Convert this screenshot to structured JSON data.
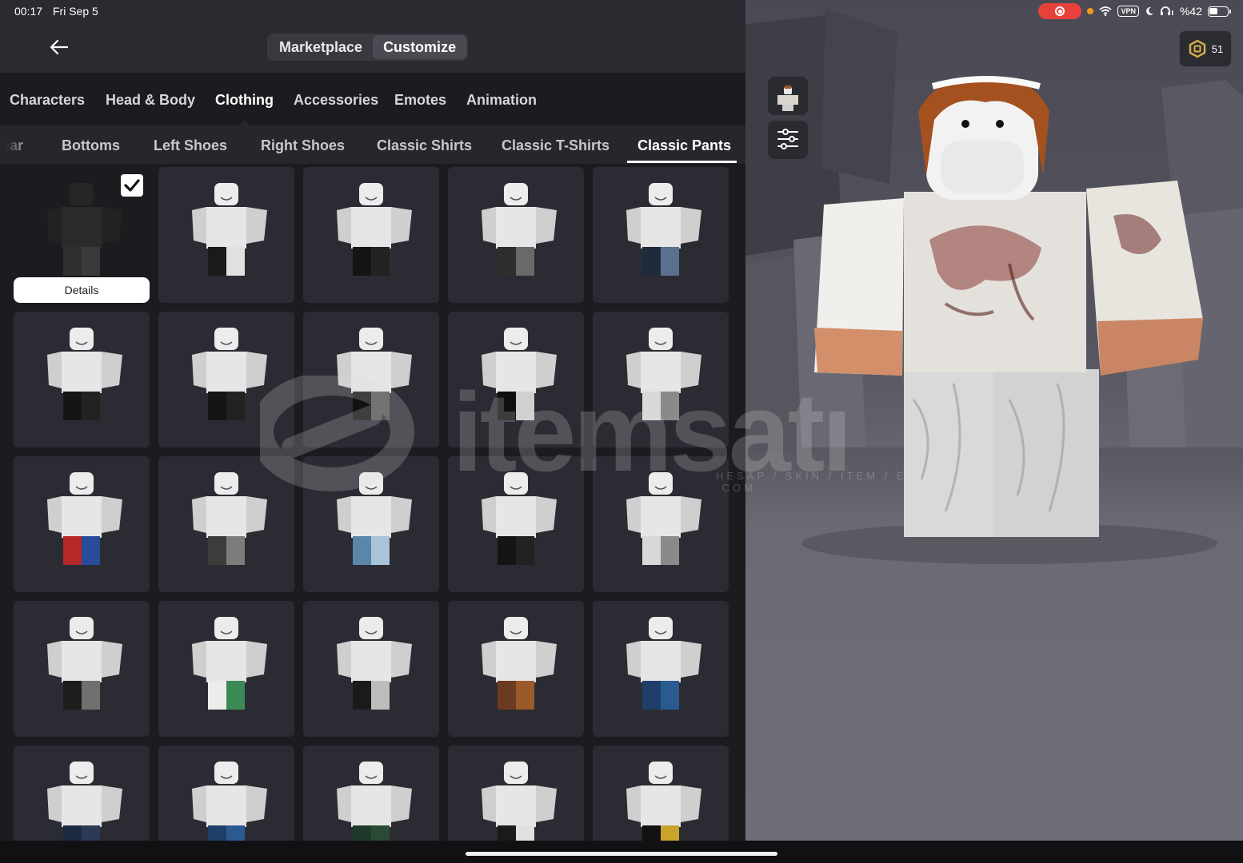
{
  "status_bar": {
    "time": "00:17",
    "date": "Fri Sep 5",
    "battery": "%42",
    "vpn": "VPN"
  },
  "header": {
    "tabs": [
      {
        "label": "Marketplace",
        "active": false
      },
      {
        "label": "Customize",
        "active": true
      }
    ],
    "robux_count": "51"
  },
  "categories": [
    {
      "label": "Characters",
      "active": false
    },
    {
      "label": "Head & Body",
      "active": false
    },
    {
      "label": "Clothing",
      "active": true
    },
    {
      "label": "Accessories",
      "active": false
    },
    {
      "label": "Emotes",
      "active": false
    },
    {
      "label": "Animation",
      "active": false
    }
  ],
  "subcategories": [
    {
      "label": "ear",
      "active": false
    },
    {
      "label": "Bottoms",
      "active": false
    },
    {
      "label": "Left Shoes",
      "active": false
    },
    {
      "label": "Right Shoes",
      "active": false
    },
    {
      "label": "Classic Shirts",
      "active": false
    },
    {
      "label": "Classic T-Shirts",
      "active": false
    },
    {
      "label": "Classic Pants",
      "active": true
    }
  ],
  "selected_item": {
    "details_label": "Details"
  },
  "items": [
    {
      "pants": "dark",
      "selected": true
    },
    {
      "pants": "black-white"
    },
    {
      "pants": "black"
    },
    {
      "pants": "dark-gray"
    },
    {
      "pants": "dark-blue-denim"
    },
    {
      "pants": "black"
    },
    {
      "pants": "black"
    },
    {
      "pants": "black-belt"
    },
    {
      "pants": "black-chain-shirt"
    },
    {
      "pants": "white-gray"
    },
    {
      "pants": "red-blue"
    },
    {
      "pants": "gray"
    },
    {
      "pants": "light-blue"
    },
    {
      "pants": "black"
    },
    {
      "pants": "white-gray"
    },
    {
      "pants": "black-gray"
    },
    {
      "pants": "white-green"
    },
    {
      "pants": "black-skeleton"
    },
    {
      "pants": "brown"
    },
    {
      "pants": "blue"
    },
    {
      "pants": "navy"
    },
    {
      "pants": "blue"
    },
    {
      "pants": "green"
    },
    {
      "pants": "black-white"
    },
    {
      "pants": "black-gold"
    }
  ],
  "colors": {
    "panel": "#1b1c20",
    "topbar": "#2a2b30",
    "tile": "#2b2c33",
    "accent": "#ffffff"
  },
  "watermark": {
    "brand": "itemsatı",
    "tagline": "HESAP / SKIN / ITEM / E-PIN .COM"
  }
}
